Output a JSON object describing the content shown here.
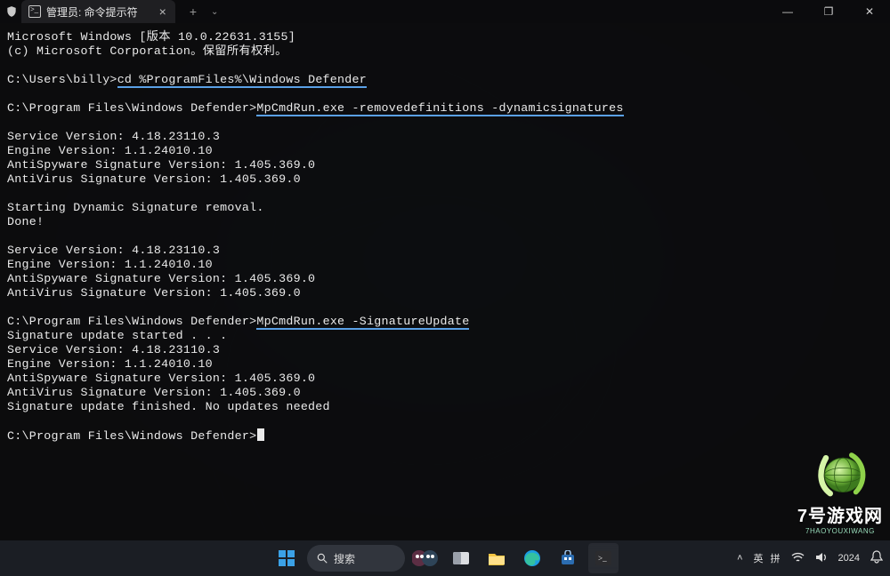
{
  "window": {
    "tab_title": "管理员: 命令提示符",
    "controls": {
      "minimize": "—",
      "maximize": "❐",
      "close": "✕"
    },
    "new_tab": "+",
    "chevron": "⌄"
  },
  "terminal": {
    "lines": [
      {
        "t": "Microsoft Windows [版本 10.0.22631.3155]"
      },
      {
        "t": "(c) Microsoft Corporation。保留所有权利。"
      },
      {
        "t": ""
      },
      {
        "p": "C:\\Users\\billy>",
        "c": "cd %ProgramFiles%\\Windows Defender",
        "hl": true
      },
      {
        "t": ""
      },
      {
        "p": "C:\\Program Files\\Windows Defender>",
        "c": "MpCmdRun.exe -removedefinitions -dynamicsignatures",
        "hl": true
      },
      {
        "t": ""
      },
      {
        "t": "Service Version: 4.18.23110.3"
      },
      {
        "t": "Engine Version: 1.1.24010.10"
      },
      {
        "t": "AntiSpyware Signature Version: 1.405.369.0"
      },
      {
        "t": "AntiVirus Signature Version: 1.405.369.0"
      },
      {
        "t": ""
      },
      {
        "t": "Starting Dynamic Signature removal."
      },
      {
        "t": "Done!"
      },
      {
        "t": ""
      },
      {
        "t": "Service Version: 4.18.23110.3"
      },
      {
        "t": "Engine Version: 1.1.24010.10"
      },
      {
        "t": "AntiSpyware Signature Version: 1.405.369.0"
      },
      {
        "t": "AntiVirus Signature Version: 1.405.369.0"
      },
      {
        "t": ""
      },
      {
        "p": "C:\\Program Files\\Windows Defender>",
        "c": "MpCmdRun.exe -SignatureUpdate",
        "hl": true
      },
      {
        "t": "Signature update started . . ."
      },
      {
        "t": "Service Version: 4.18.23110.3"
      },
      {
        "t": "Engine Version: 1.1.24010.10"
      },
      {
        "t": "AntiSpyware Signature Version: 1.405.369.0"
      },
      {
        "t": "AntiVirus Signature Version: 1.405.369.0"
      },
      {
        "t": "Signature update finished. No updates needed"
      },
      {
        "t": ""
      },
      {
        "p": "C:\\Program Files\\Windows Defender>",
        "c": "",
        "cursor": true
      }
    ]
  },
  "taskbar": {
    "search_placeholder": "搜索",
    "tray": {
      "chevron": "˄",
      "lang1": "英",
      "lang2": "拼",
      "year": "2024"
    }
  },
  "watermark": {
    "title": "7号游戏网",
    "sub": "7HAOYOUXIWANG"
  }
}
